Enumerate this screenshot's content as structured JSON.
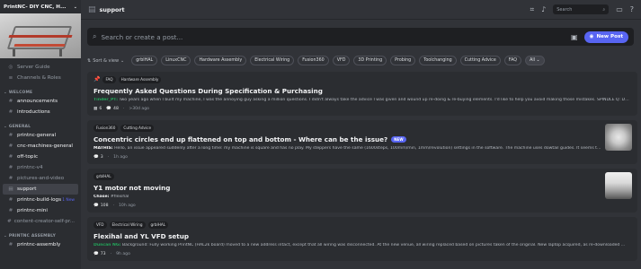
{
  "server": {
    "name": "PrintNC- DIY CNC, H...",
    "chevron": "⌄"
  },
  "sidebar": {
    "top_items": [
      {
        "icon": "compass-icon",
        "glyph": "◎",
        "label": "Server Guide"
      },
      {
        "icon": "list-icon",
        "glyph": "≡",
        "label": "Channels & Roles"
      }
    ],
    "categories": [
      {
        "name": "WELCOME",
        "items": [
          {
            "glyph": "#",
            "label": "announcements",
            "bright": true
          },
          {
            "glyph": "#",
            "label": "introductions",
            "bright": true
          }
        ]
      },
      {
        "name": "GENERAL",
        "items": [
          {
            "glyph": "#",
            "label": "printnc-general",
            "bright": true
          },
          {
            "glyph": "#",
            "label": "cnc-machines-general",
            "bright": true
          },
          {
            "glyph": "#",
            "label": "off-topic",
            "bright": true
          },
          {
            "glyph": "#",
            "label": "printnc-v4",
            "bright": false
          },
          {
            "glyph": "#",
            "label": "pictures-and-video",
            "bright": false
          },
          {
            "glyph": "▤",
            "label": "support",
            "bright": false,
            "active": true
          },
          {
            "glyph": "#",
            "label": "printnc-build-logs",
            "bright": true,
            "badge": "1 New"
          },
          {
            "glyph": "#",
            "label": "printnc-mini",
            "bright": true
          },
          {
            "glyph": "#",
            "label": "content-creator-self-pr...",
            "bright": false
          }
        ]
      },
      {
        "name": "PRINTNC ASSEMBLY",
        "items": [
          {
            "glyph": "#",
            "label": "printnc-assembly",
            "bright": true
          }
        ]
      }
    ]
  },
  "topbar": {
    "channel": "support",
    "search_placeholder": "Search",
    "icons": [
      "threads-icon",
      "bell-icon",
      "inbox-icon",
      "help-icon"
    ]
  },
  "forum": {
    "search_placeholder": "Search or create a post...",
    "new_post": "New Post",
    "sort_label": "Sort & view",
    "tags": [
      "grblHAL",
      "LinuxCNC",
      "Hardware Assembly",
      "Electrical Wiring",
      "Fusion360",
      "VFD",
      "3D Printing",
      "Probing",
      "Toolchanging",
      "Cutting Advice",
      "FAQ"
    ],
    "all_label": "All"
  },
  "posts": [
    {
      "tags": [
        "FAQ",
        "Hardware Assembly"
      ],
      "pinned": true,
      "title": "Frequently Asked Questions During Specification & Purchasing",
      "author": "Tinder_PT:",
      "author_green": true,
      "excerpt": " Two years ago when I built my machine, I was the annoying guy asking a million questions. I didn't always take the advice I was given and wound up re-doing & re-buying elements. I'd like to help you avoid making those mistakes. SPINDLE Q: Do I ...",
      "reaction_count": "6",
      "message_count": "48",
      "time": ">30d ago",
      "thumb": ""
    },
    {
      "tags": [
        "Fusion360",
        "Cutting Advice"
      ],
      "title": "Concentric circles end up flattened on top and bottom - Where can be the issue?",
      "new_label": "NEW",
      "author": "MATHIS:",
      "author_green": false,
      "excerpt": " Hello, an issue appeared suddenly after a long time: my machine is square and has no play. My steppers have the same (1600steps, 100mm/min, 1mm/revolution) settings in the software. The machine uses dowtail guides. It seems t...",
      "message_count": "3",
      "time": "1h ago",
      "thumb": "a"
    },
    {
      "tags": [
        "grblHAL"
      ],
      "title": "Y1 motor not moving",
      "author": "Chase:",
      "author_green": false,
      "excerpt": " #flexihal",
      "message_count": "108",
      "time": "10h ago",
      "thumb": "b"
    },
    {
      "tags": [
        "VFD",
        "Electrical Wiring",
        "grblHAL"
      ],
      "title": "Flexihal and YL VFD setup",
      "author": "Duncan NG:",
      "author_green": true,
      "excerpt": " Background: Fully working PrintNC (HAL2k board) moved to a new address intact, except that all wiring was disconnected. At the new venue, all wiring replaced based on pictures taken of the original. New laptop acquired, as re-downloaded ...",
      "message_count": "73",
      "time": "9h ago",
      "thumb": ""
    }
  ]
}
